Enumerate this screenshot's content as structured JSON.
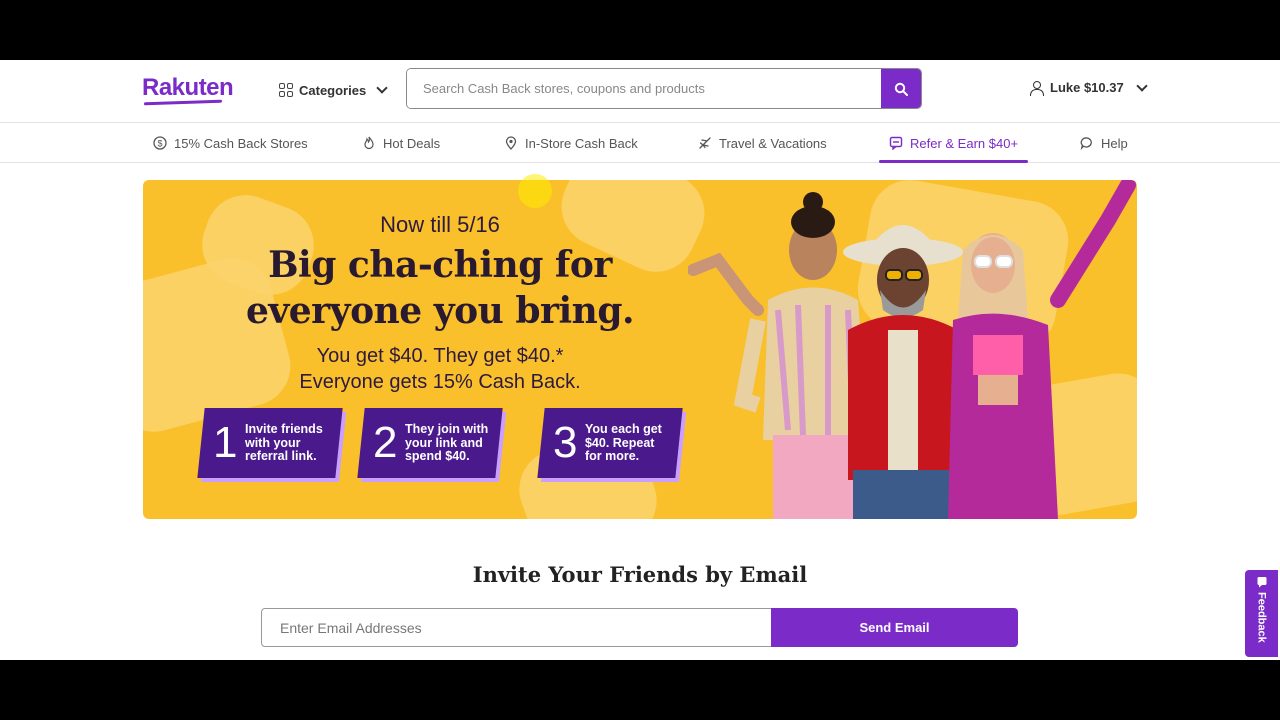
{
  "header": {
    "logo": "Rakuten",
    "categories_label": "Categories",
    "search_placeholder": "Search Cash Back stores, coupons and products",
    "account_label": "Luke $10.37"
  },
  "nav": {
    "items": [
      {
        "label": "15% Cash Back Stores",
        "icon": "dollar-circle-icon"
      },
      {
        "label": "Hot Deals",
        "icon": "flame-icon"
      },
      {
        "label": "In-Store Cash Back",
        "icon": "location-pin-icon"
      },
      {
        "label": "Travel & Vacations",
        "icon": "airplane-icon"
      },
      {
        "label": "Refer & Earn $40+",
        "icon": "gift-chat-icon",
        "active": true
      },
      {
        "label": "Help",
        "icon": "chat-bubble-icon"
      }
    ]
  },
  "hero": {
    "date": "Now till 5/16",
    "title_line1": "Big cha-ching for",
    "title_line2": "everyone you bring.",
    "sub_line1": "You get $40. They get $40.*",
    "sub_line2": "Everyone gets 15% Cash Back.",
    "steps": [
      {
        "num": "1",
        "text": "Invite friends with your referral link."
      },
      {
        "num": "2",
        "text": "They join with your link and spend $40."
      },
      {
        "num": "3",
        "text": "You each get $40. Repeat for more."
      }
    ]
  },
  "invite": {
    "title": "Invite Your Friends by Email",
    "email_placeholder": "Enter Email Addresses",
    "send_label": "Send Email"
  },
  "feedback_label": "Feedback",
  "colors": {
    "brand": "#7a2bc8",
    "hero_bg": "#f9c02b",
    "step_bg": "#4a1a8c"
  }
}
